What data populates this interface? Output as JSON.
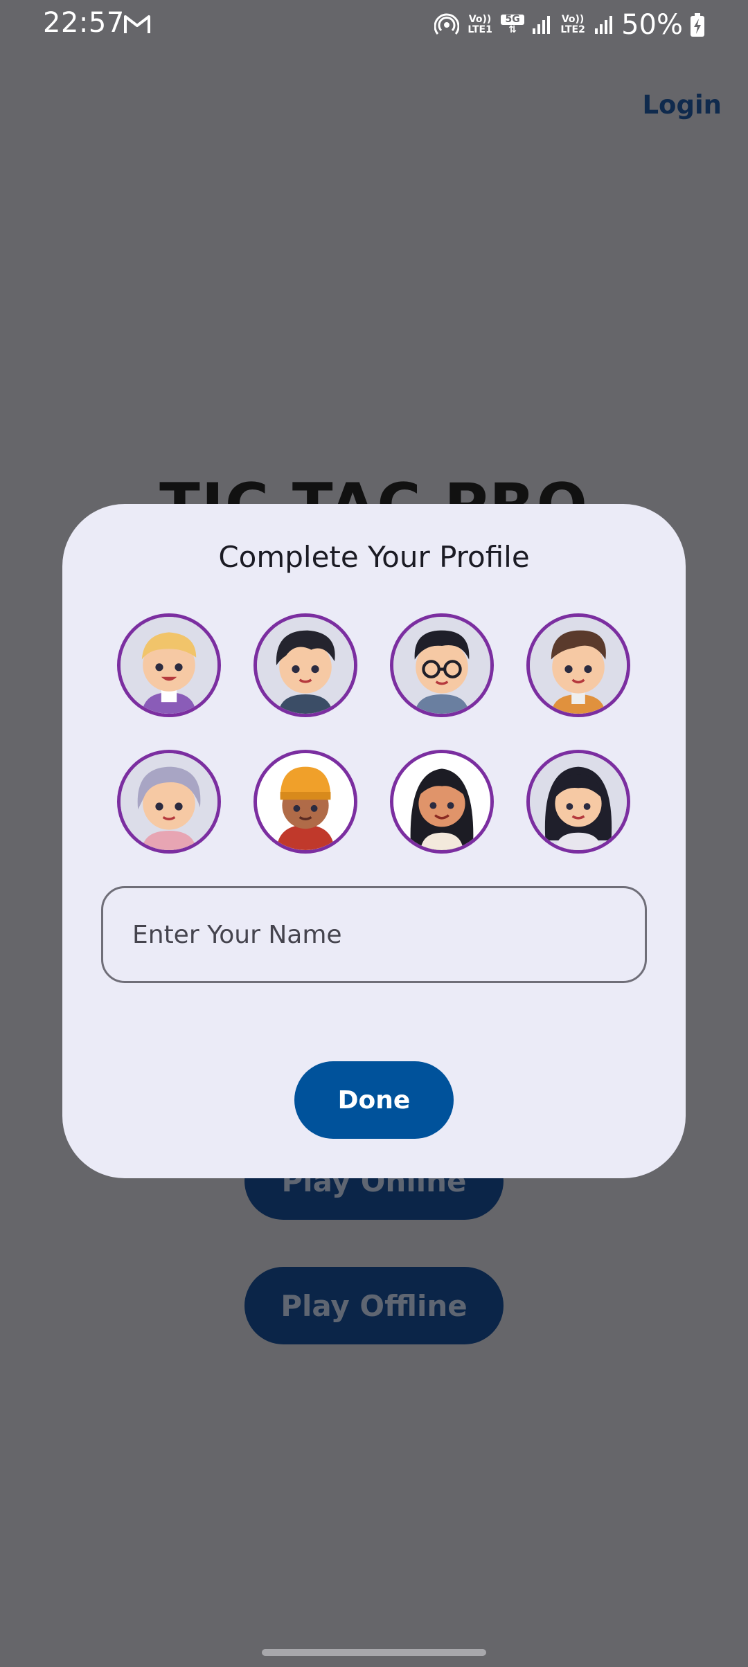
{
  "status_bar": {
    "time": "22:57",
    "battery": "50%",
    "sim1_top": "Vo))",
    "sim1_bottom": "LTE1",
    "network_badge": "5G",
    "sim2_top": "Vo))",
    "sim2_bottom": "LTE2"
  },
  "background": {
    "login_label": "Login",
    "app_title": "TIC TAC PRO",
    "play_online_label": "Play Online",
    "play_offline_label": "Play Offline"
  },
  "dialog": {
    "title": "Complete Your Profile",
    "avatars": [
      {
        "name": "boy-blond-avatar"
      },
      {
        "name": "boy-black-hair-avatar"
      },
      {
        "name": "boy-glasses-avatar"
      },
      {
        "name": "boy-brown-hair-avatar"
      },
      {
        "name": "child-gray-hair-avatar"
      },
      {
        "name": "child-beanie-avatar"
      },
      {
        "name": "girl-long-hair-avatar"
      },
      {
        "name": "girl-black-hair-avatar"
      }
    ],
    "name_placeholder": "Enter Your Name",
    "name_value": "",
    "done_label": "Done"
  },
  "colors": {
    "overlay": "#66666a",
    "dialog_bg": "#ebebf7",
    "avatar_border": "#7b2ea0",
    "primary": "#00529b"
  }
}
